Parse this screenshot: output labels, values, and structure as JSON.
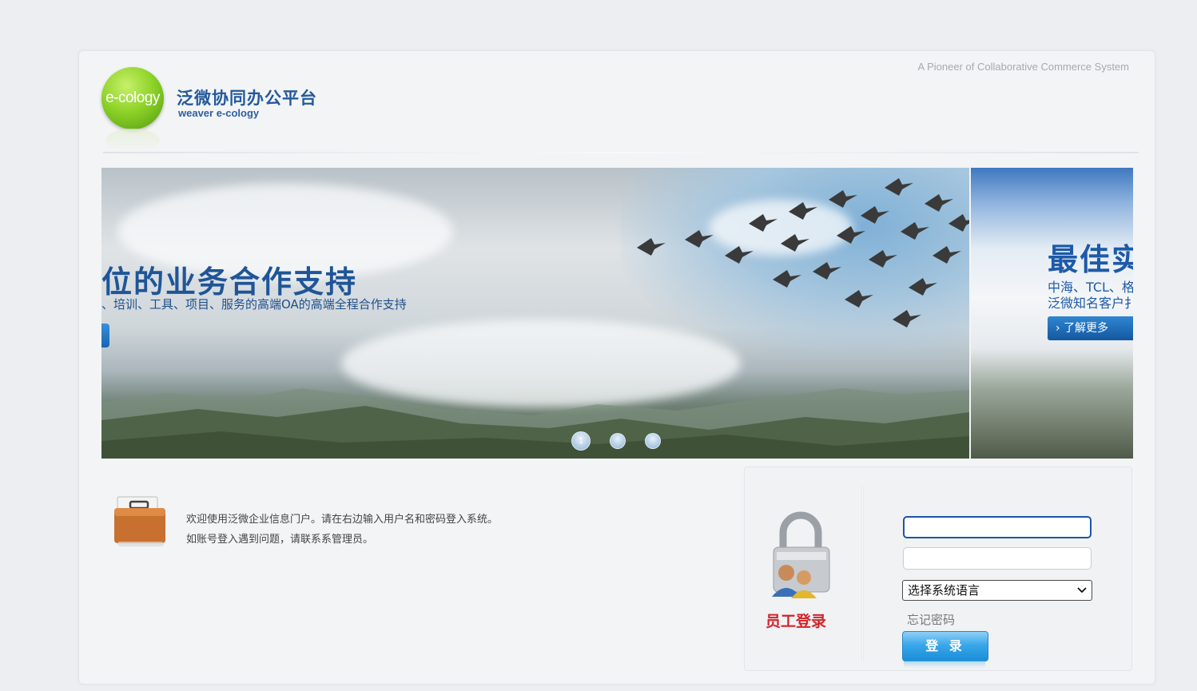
{
  "header": {
    "tagline": "A Pioneer of Collaborative Commerce System",
    "logo_text": "e-cology",
    "brand_cn": "泛微协同办公平台",
    "brand_en": "weaver e-cology"
  },
  "banner": {
    "main_slide": {
      "title": "位的业务合作支持",
      "subtitle": "、培训、工具、项目、服务的高端OA的高端全程合作支持"
    },
    "side_slide": {
      "title": "最佳实",
      "line1": "中海、TCL、格",
      "line2": "泛微知名客户扌",
      "button": "了解更多"
    },
    "dots": [
      "1",
      "",
      ""
    ]
  },
  "welcome": {
    "line1": "欢迎使用泛微企业信息门户。请在右边输入用户名和密码登入系统。",
    "line2": "如账号登入遇到问题，请联系系管理员。"
  },
  "login": {
    "label": "员工登录",
    "username_value": "",
    "password_value": "",
    "language_selected": "选择系统语言",
    "forgot": "忘记密码",
    "submit": "登 录"
  },
  "colors": {
    "brand_blue": "#245a9c",
    "login_red": "#d2242a",
    "button_blue": "#1a8ed8"
  }
}
